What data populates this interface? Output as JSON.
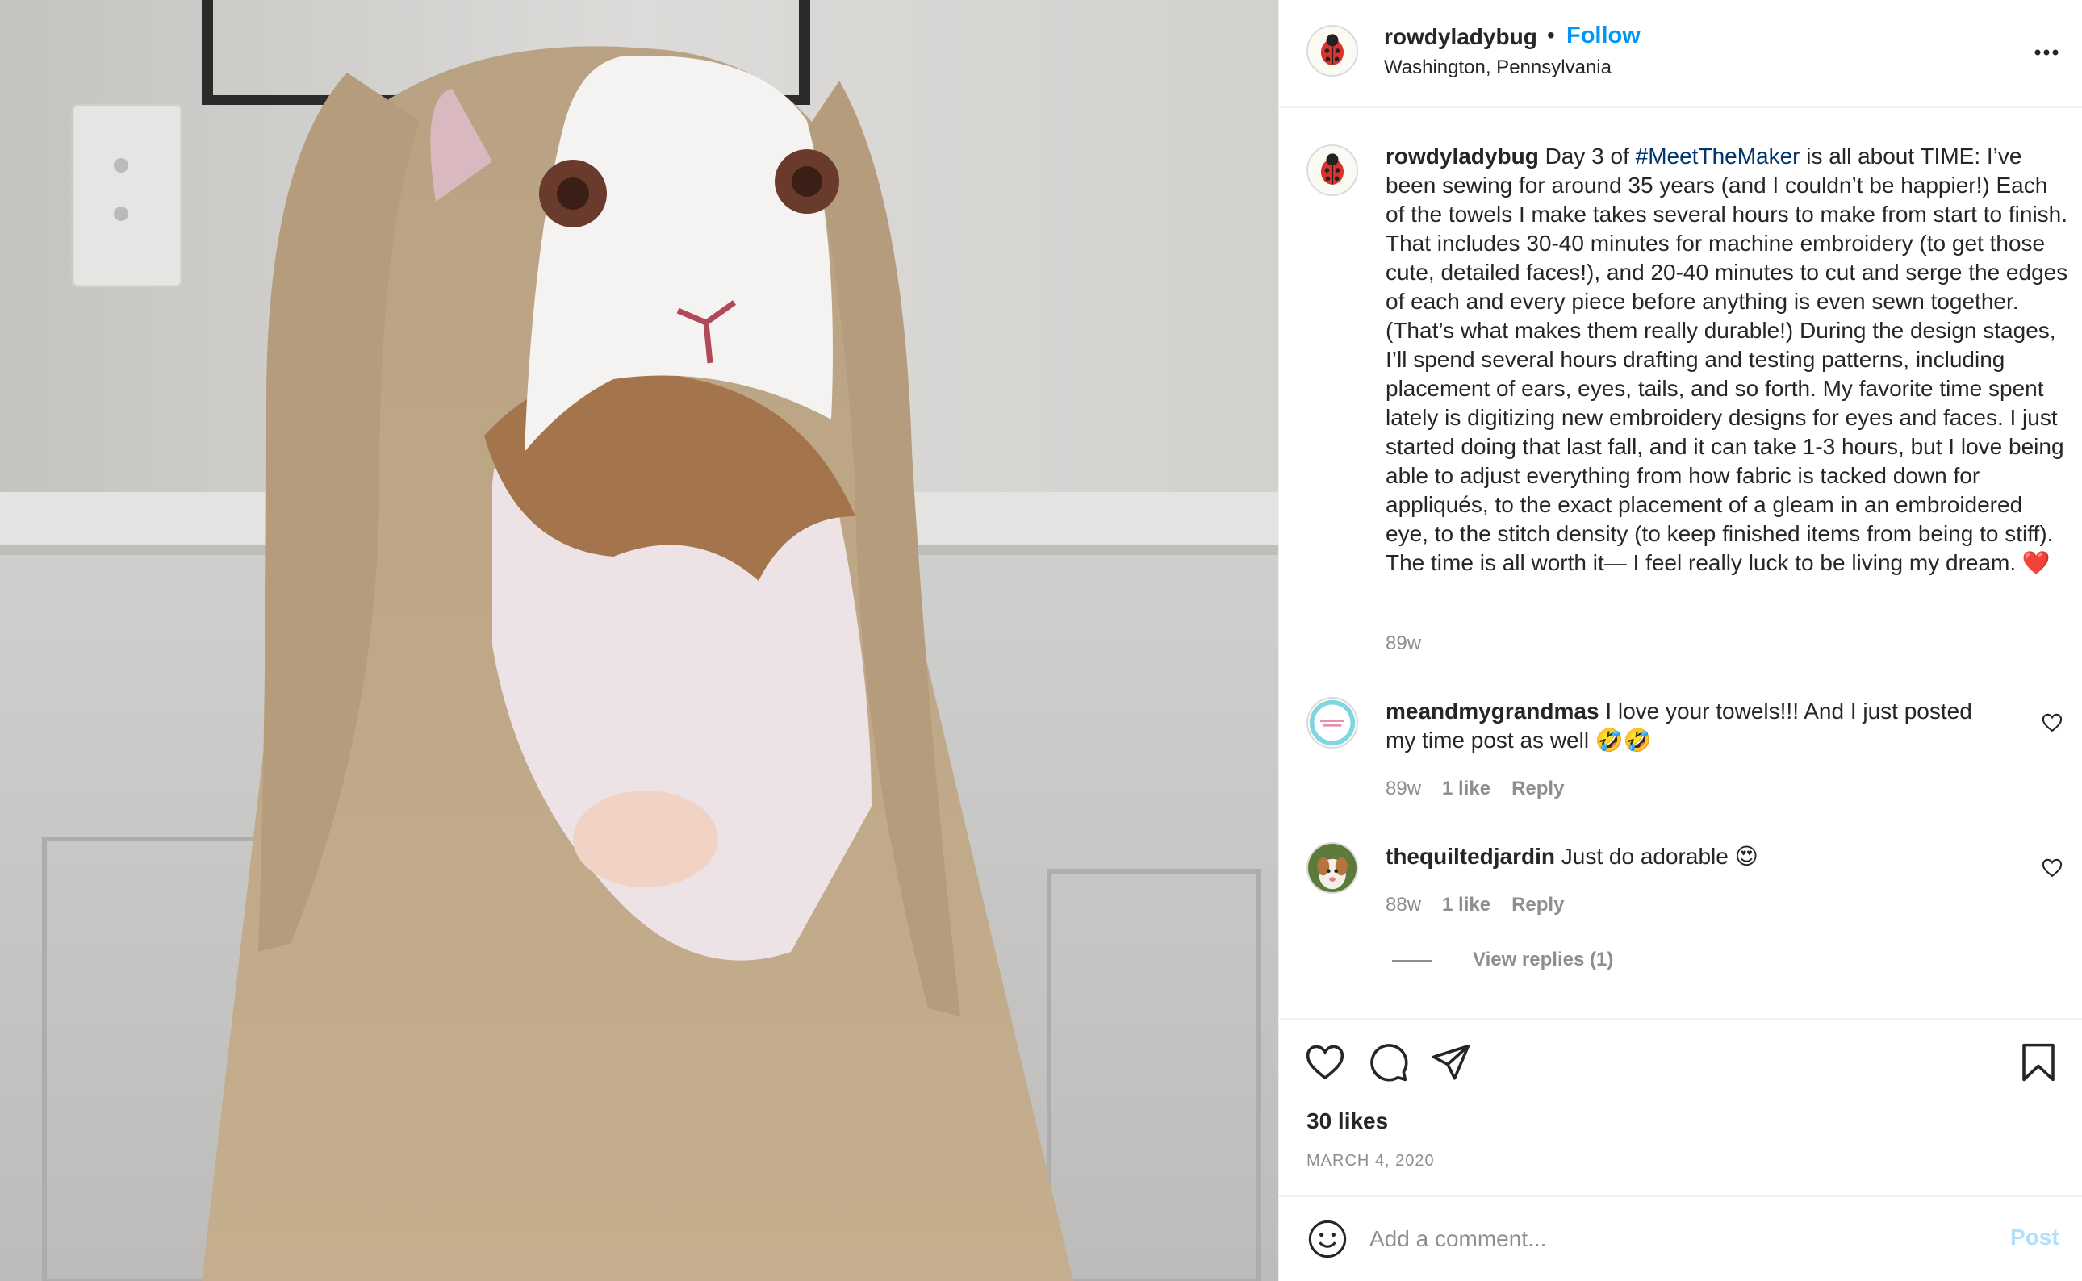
{
  "post": {
    "username": "rowdyladybug",
    "separator": "•",
    "follow_label": "Follow",
    "location": "Washington, Pennsylvania",
    "avatar_icon": "ladybug-avatar",
    "more_icon": "more-options-icon"
  },
  "caption": {
    "username": "rowdyladybug",
    "text_before_hashtag": " Day 3 of ",
    "hashtag": "#MeetTheMaker",
    "text_after_hashtag": " is all about TIME: I’ve been sewing for around 35 years (and I couldn’t be happier!) Each of the towels I make takes several hours to make from start to finish. That includes 30-40 minutes for machine embroidery (to get those cute, detailed faces!), and 20-40 minutes to cut and serge the edges of each and every piece before anything is even sewn together. (That’s what makes them really durable!) During the design stages, I’ll spend several hours drafting and testing patterns, including placement of ears, eyes, tails, and so forth. My favorite time spent lately is digitizing new embroidery designs for eyes and faces. I just started doing that last fall, and it can take 1-3 hours, but I love being able to adjust everything from how fabric is tacked down for appliqués, to the exact placement of a gleam in an embroidered eye, to the stitch density (to keep finished items from being to stiff). The time is all worth it— I feel really luck to be living my dream. ❤️",
    "time": "89w"
  },
  "comments": [
    {
      "username": "meandmygrandmas",
      "text": " I love your towels!!! And I just posted my time post as well 🤣🤣",
      "time": "89w",
      "likes": "1 like",
      "reply_label": "Reply"
    },
    {
      "username": "thequiltedjardin",
      "text": " Just do adorable 😍",
      "time": "88w",
      "likes": "1 like",
      "reply_label": "Reply"
    }
  ],
  "view_replies_label": "View replies (1)",
  "actions": {
    "like_icon": "heart-icon",
    "comment_icon": "comment-bubble-icon",
    "share_icon": "paper-plane-icon",
    "save_icon": "bookmark-icon"
  },
  "likes_count": "30 likes",
  "post_date": "MARCH 4, 2020",
  "comment_box": {
    "placeholder": "Add a comment...",
    "post_label": "Post",
    "emoji_icon": "smiley-icon"
  },
  "colors": {
    "follow_blue": "#0095f6",
    "hashtag_blue": "#00376b",
    "post_button_disabled": "#b2dffc",
    "muted_text": "#8e8e8e",
    "border": "#efefef"
  }
}
